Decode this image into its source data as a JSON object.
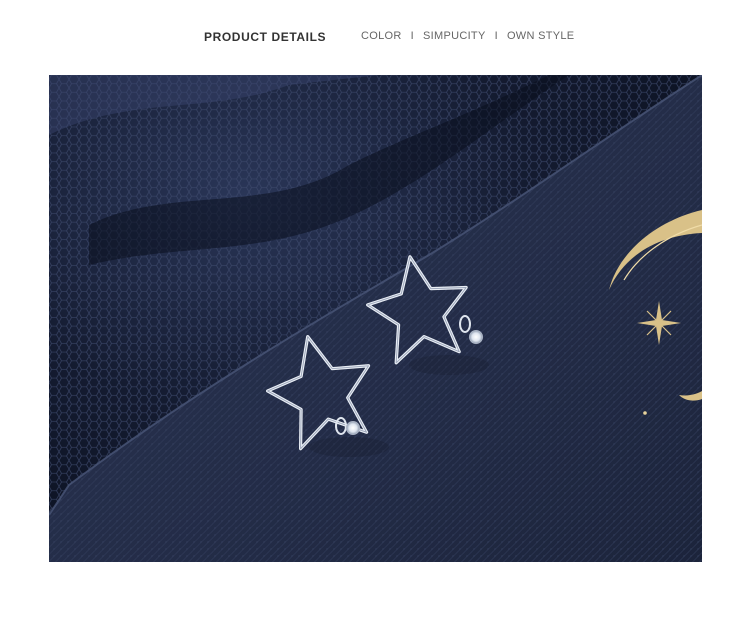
{
  "header": {
    "title": "PRODUCT DETAILS",
    "tags": [
      "COLOR",
      "SIMPUCITY",
      "OWN STYLE"
    ],
    "separator": "I"
  },
  "photo": {
    "subject": "star-outline-earrings",
    "colors": {
      "tulle": "#10172b",
      "board": "#27314c",
      "foil": "#d9c188",
      "silver": "#e9eef5"
    }
  }
}
